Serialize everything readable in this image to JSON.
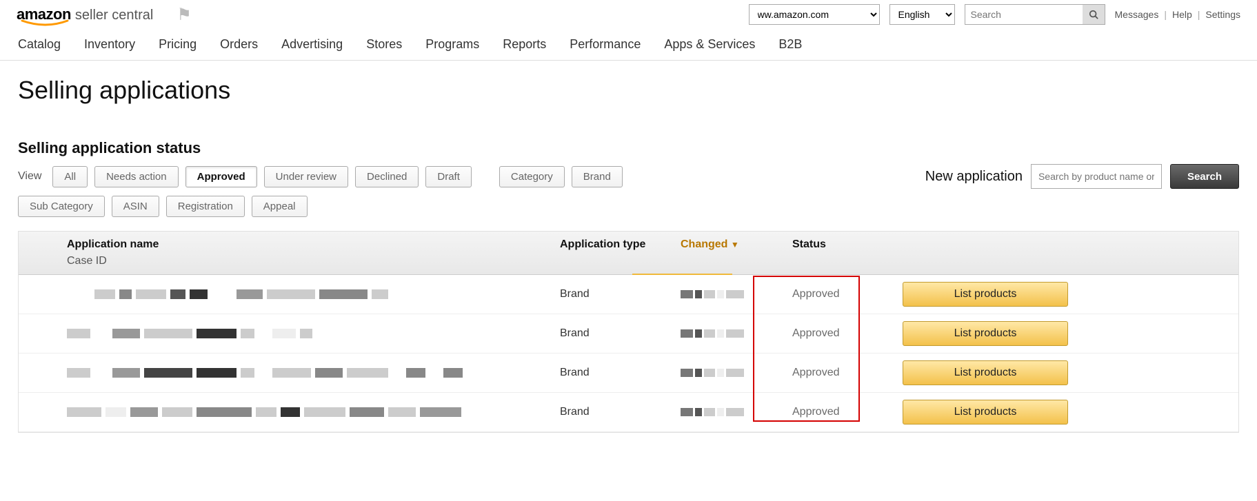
{
  "brand": {
    "amazon": "amazon",
    "seller": "seller central"
  },
  "header": {
    "marketplace_selected": "ww.amazon.com",
    "language_selected": "English",
    "search_placeholder": "Search",
    "links": {
      "messages": "Messages",
      "help": "Help",
      "settings": "Settings"
    }
  },
  "nav": {
    "items": [
      "Catalog",
      "Inventory",
      "Pricing",
      "Orders",
      "Advertising",
      "Stores",
      "Programs",
      "Reports",
      "Performance",
      "Apps & Services",
      "B2B"
    ]
  },
  "page": {
    "title": "Selling applications",
    "section_title": "Selling application status",
    "view_label": "View",
    "filters_row1": [
      {
        "label": "All",
        "active": false
      },
      {
        "label": "Needs action",
        "active": false
      },
      {
        "label": "Approved",
        "active": true
      },
      {
        "label": "Under review",
        "active": false
      },
      {
        "label": "Declined",
        "active": false
      },
      {
        "label": "Draft",
        "active": false
      }
    ],
    "type_filters": [
      {
        "label": "Category"
      },
      {
        "label": "Brand"
      }
    ],
    "filters_row2": [
      {
        "label": "Sub Category"
      },
      {
        "label": "ASIN"
      },
      {
        "label": "Registration"
      },
      {
        "label": "Appeal"
      }
    ],
    "new_application": {
      "label": "New application",
      "input_placeholder": "Search by product name or ASIN",
      "button": "Search"
    }
  },
  "table": {
    "headers": {
      "name_top": "Application name",
      "name_bottom": "Case ID",
      "type": "Application type",
      "changed": "Changed",
      "status": "Status"
    },
    "rows": [
      {
        "type": "Brand",
        "status": "Approved",
        "action": "List products"
      },
      {
        "type": "Brand",
        "status": "Approved",
        "action": "List products"
      },
      {
        "type": "Brand",
        "status": "Approved",
        "action": "List products"
      },
      {
        "type": "Brand",
        "status": "Approved",
        "action": "List products"
      }
    ]
  }
}
